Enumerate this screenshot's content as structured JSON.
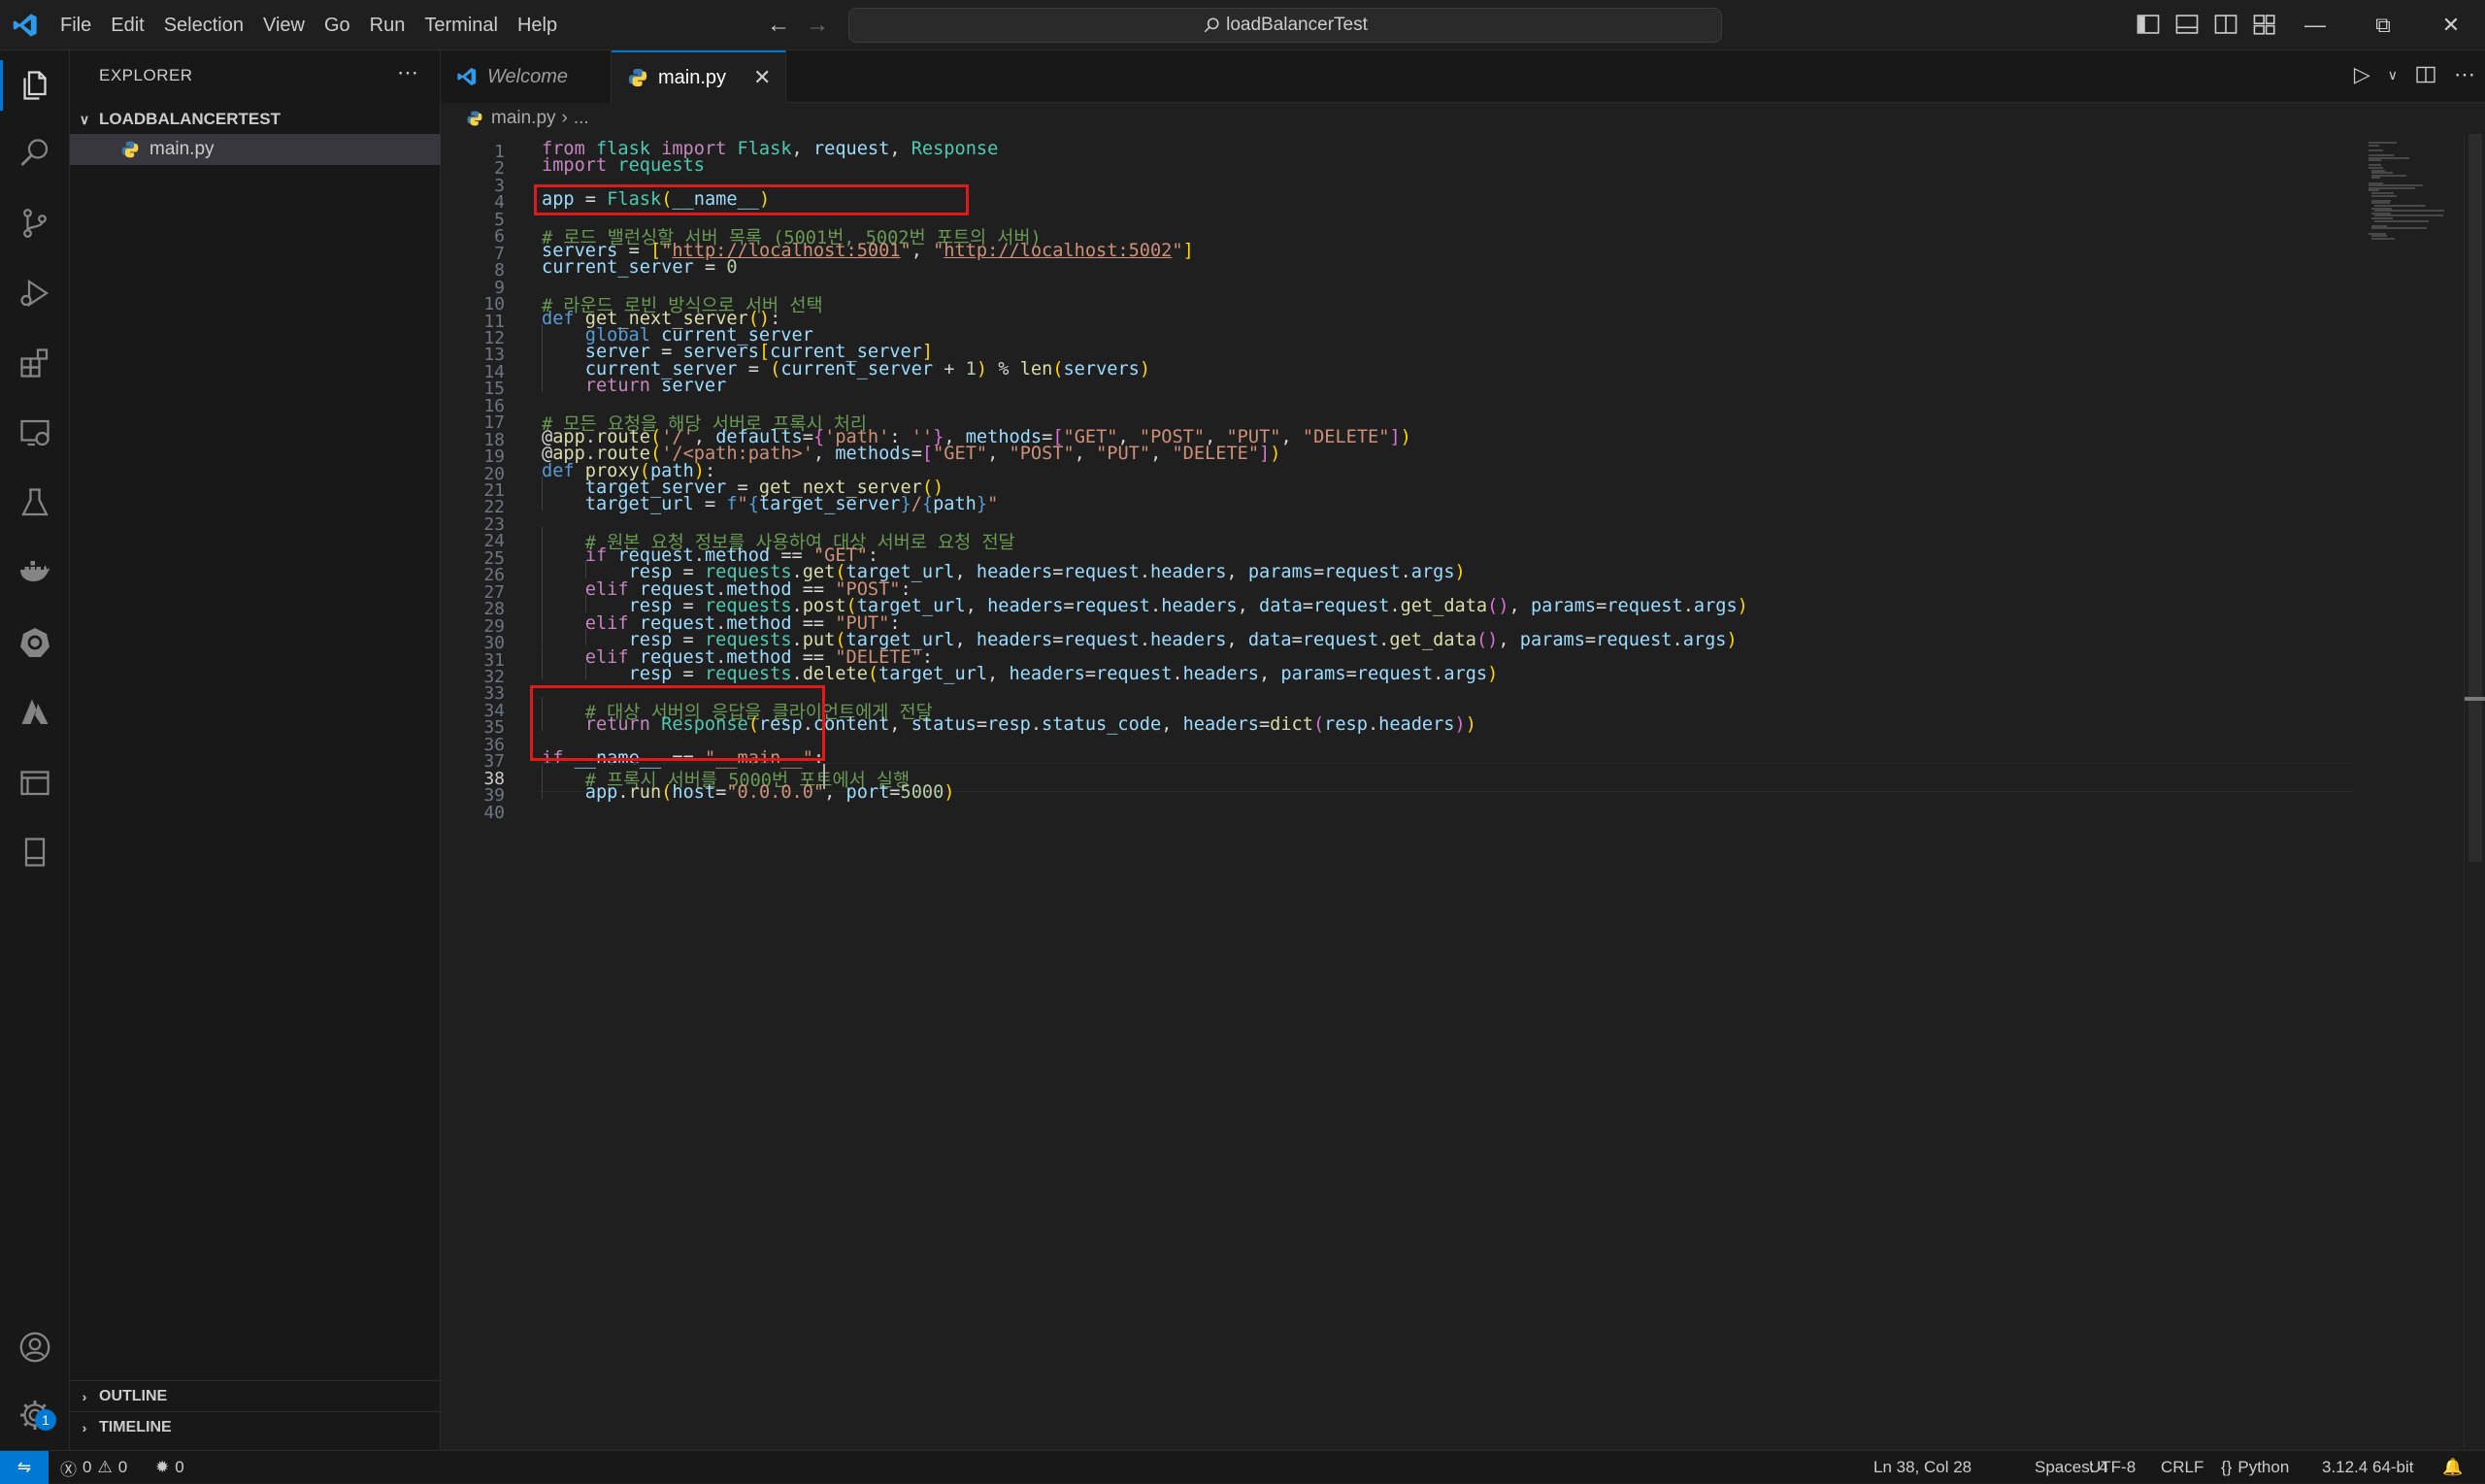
{
  "menu": [
    "File",
    "Edit",
    "Selection",
    "View",
    "Go",
    "Run",
    "Terminal",
    "Help"
  ],
  "command_center": {
    "label": "loadBalancerTest"
  },
  "sidebar": {
    "title": "EXPLORER",
    "folder": "LOADBALANCERTEST",
    "files": [
      "main.py"
    ],
    "sections": [
      "OUTLINE",
      "TIMELINE"
    ]
  },
  "tabs": [
    {
      "label": "Welcome",
      "active": false
    },
    {
      "label": "main.py",
      "active": true
    }
  ],
  "breadcrumbs": {
    "file": "main.py",
    "rest": "..."
  },
  "editor": {
    "language": "Python",
    "line_numbers": [
      "1",
      "2",
      "3",
      "4",
      "5",
      "6",
      "7",
      "8",
      "9",
      "10",
      "11",
      "12",
      "13",
      "14",
      "15",
      "16",
      "17",
      "18",
      "19",
      "20",
      "21",
      "22",
      "23",
      "24",
      "25",
      "26",
      "27",
      "28",
      "29",
      "30",
      "31",
      "32",
      "33",
      "34",
      "35",
      "36",
      "37",
      "38",
      "39",
      "40"
    ],
    "current_line": 38,
    "code": [
      "from flask import Flask, request, Response",
      "import requests",
      "",
      "app = Flask(__name__)",
      "",
      "# 로드 밸런싱할 서버 목록 (5001번, 5002번 포트의 서버)",
      "servers = [\"http://localhost:5001\", \"http://localhost:5002\"]",
      "current_server = 0",
      "",
      "# 라운드 로빈 방식으로 서버 선택",
      "def get_next_server():",
      "    global current_server",
      "    server = servers[current_server]",
      "    current_server = (current_server + 1) % len(servers)",
      "    return server",
      "",
      "# 모든 요청을 해당 서버로 프록시 처리",
      "@app.route('/', defaults={'path': ''}, methods=[\"GET\", \"POST\", \"PUT\", \"DELETE\"])",
      "@app.route('/<path:path>', methods=[\"GET\", \"POST\", \"PUT\", \"DELETE\"])",
      "def proxy(path):",
      "    target_server = get_next_server()",
      "    target_url = f\"{target_server}/{path}\"",
      "",
      "    # 원본 요청 정보를 사용하여 대상 서버로 요청 전달",
      "    if request.method == \"GET\":",
      "        resp = requests.get(target_url, headers=request.headers, params=request.args)",
      "    elif request.method == \"POST\":",
      "        resp = requests.post(target_url, headers=request.headers, data=request.get_data(), params=request.args)",
      "    elif request.method == \"PUT\":",
      "        resp = requests.put(target_url, headers=request.headers, data=request.get_data(), params=request.args)",
      "    elif request.method == \"DELETE\":",
      "        resp = requests.delete(target_url, headers=request.headers, params=request.args)",
      "",
      "    # 대상 서버의 응답을 클라이언트에게 전달",
      "    return Response(resp.content, status=resp.status_code, headers=dict(resp.headers))",
      "",
      "if __name__ == \"__main__\":",
      "    # 프록시 서버를 5000번 포트에서 실행",
      "    app.run(host=\"0.0.0.0\", port=5000)",
      ""
    ]
  },
  "status": {
    "errors": "0",
    "warnings": "0",
    "ports": "0",
    "cursor": "Ln 38, Col 28",
    "spaces": "Spaces: 4",
    "encoding": "UTF-8",
    "eol": "CRLF",
    "language": "Python",
    "interpreter": "3.12.4 64-bit"
  },
  "activity_badge": "1",
  "colors": {
    "accent": "#0078d4",
    "highlight_box": "#e0191b",
    "editor_bg": "#1f1f1f"
  }
}
